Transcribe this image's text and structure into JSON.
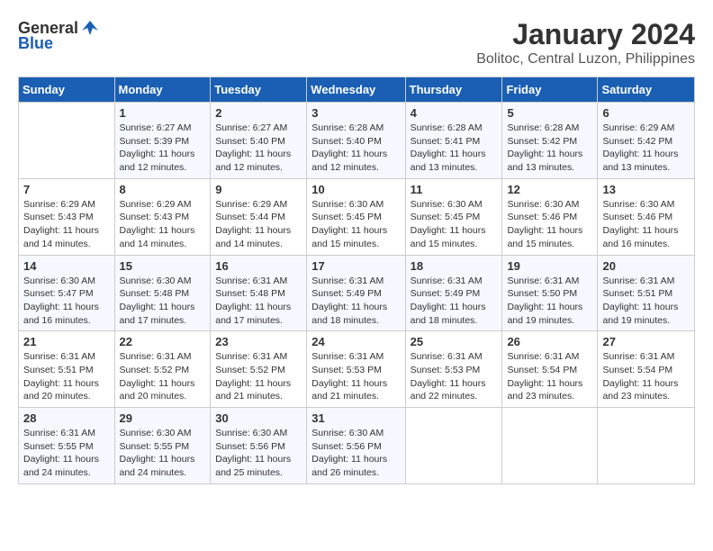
{
  "logo": {
    "general": "General",
    "blue": "Blue"
  },
  "title": "January 2024",
  "location": "Bolitoc, Central Luzon, Philippines",
  "days_header": [
    "Sunday",
    "Monday",
    "Tuesday",
    "Wednesday",
    "Thursday",
    "Friday",
    "Saturday"
  ],
  "weeks": [
    [
      {
        "day": "",
        "sunrise": "",
        "sunset": "",
        "daylight": ""
      },
      {
        "day": "1",
        "sunrise": "6:27 AM",
        "sunset": "5:39 PM",
        "daylight": "11 hours and 12 minutes."
      },
      {
        "day": "2",
        "sunrise": "6:27 AM",
        "sunset": "5:40 PM",
        "daylight": "11 hours and 12 minutes."
      },
      {
        "day": "3",
        "sunrise": "6:28 AM",
        "sunset": "5:40 PM",
        "daylight": "11 hours and 12 minutes."
      },
      {
        "day": "4",
        "sunrise": "6:28 AM",
        "sunset": "5:41 PM",
        "daylight": "11 hours and 13 minutes."
      },
      {
        "day": "5",
        "sunrise": "6:28 AM",
        "sunset": "5:42 PM",
        "daylight": "11 hours and 13 minutes."
      },
      {
        "day": "6",
        "sunrise": "6:29 AM",
        "sunset": "5:42 PM",
        "daylight": "11 hours and 13 minutes."
      }
    ],
    [
      {
        "day": "7",
        "sunrise": "6:29 AM",
        "sunset": "5:43 PM",
        "daylight": "11 hours and 14 minutes."
      },
      {
        "day": "8",
        "sunrise": "6:29 AM",
        "sunset": "5:43 PM",
        "daylight": "11 hours and 14 minutes."
      },
      {
        "day": "9",
        "sunrise": "6:29 AM",
        "sunset": "5:44 PM",
        "daylight": "11 hours and 14 minutes."
      },
      {
        "day": "10",
        "sunrise": "6:30 AM",
        "sunset": "5:45 PM",
        "daylight": "11 hours and 15 minutes."
      },
      {
        "day": "11",
        "sunrise": "6:30 AM",
        "sunset": "5:45 PM",
        "daylight": "11 hours and 15 minutes."
      },
      {
        "day": "12",
        "sunrise": "6:30 AM",
        "sunset": "5:46 PM",
        "daylight": "11 hours and 15 minutes."
      },
      {
        "day": "13",
        "sunrise": "6:30 AM",
        "sunset": "5:46 PM",
        "daylight": "11 hours and 16 minutes."
      }
    ],
    [
      {
        "day": "14",
        "sunrise": "6:30 AM",
        "sunset": "5:47 PM",
        "daylight": "11 hours and 16 minutes."
      },
      {
        "day": "15",
        "sunrise": "6:30 AM",
        "sunset": "5:48 PM",
        "daylight": "11 hours and 17 minutes."
      },
      {
        "day": "16",
        "sunrise": "6:31 AM",
        "sunset": "5:48 PM",
        "daylight": "11 hours and 17 minutes."
      },
      {
        "day": "17",
        "sunrise": "6:31 AM",
        "sunset": "5:49 PM",
        "daylight": "11 hours and 18 minutes."
      },
      {
        "day": "18",
        "sunrise": "6:31 AM",
        "sunset": "5:49 PM",
        "daylight": "11 hours and 18 minutes."
      },
      {
        "day": "19",
        "sunrise": "6:31 AM",
        "sunset": "5:50 PM",
        "daylight": "11 hours and 19 minutes."
      },
      {
        "day": "20",
        "sunrise": "6:31 AM",
        "sunset": "5:51 PM",
        "daylight": "11 hours and 19 minutes."
      }
    ],
    [
      {
        "day": "21",
        "sunrise": "6:31 AM",
        "sunset": "5:51 PM",
        "daylight": "11 hours and 20 minutes."
      },
      {
        "day": "22",
        "sunrise": "6:31 AM",
        "sunset": "5:52 PM",
        "daylight": "11 hours and 20 minutes."
      },
      {
        "day": "23",
        "sunrise": "6:31 AM",
        "sunset": "5:52 PM",
        "daylight": "11 hours and 21 minutes."
      },
      {
        "day": "24",
        "sunrise": "6:31 AM",
        "sunset": "5:53 PM",
        "daylight": "11 hours and 21 minutes."
      },
      {
        "day": "25",
        "sunrise": "6:31 AM",
        "sunset": "5:53 PM",
        "daylight": "11 hours and 22 minutes."
      },
      {
        "day": "26",
        "sunrise": "6:31 AM",
        "sunset": "5:54 PM",
        "daylight": "11 hours and 23 minutes."
      },
      {
        "day": "27",
        "sunrise": "6:31 AM",
        "sunset": "5:54 PM",
        "daylight": "11 hours and 23 minutes."
      }
    ],
    [
      {
        "day": "28",
        "sunrise": "6:31 AM",
        "sunset": "5:55 PM",
        "daylight": "11 hours and 24 minutes."
      },
      {
        "day": "29",
        "sunrise": "6:30 AM",
        "sunset": "5:55 PM",
        "daylight": "11 hours and 24 minutes."
      },
      {
        "day": "30",
        "sunrise": "6:30 AM",
        "sunset": "5:56 PM",
        "daylight": "11 hours and 25 minutes."
      },
      {
        "day": "31",
        "sunrise": "6:30 AM",
        "sunset": "5:56 PM",
        "daylight": "11 hours and 26 minutes."
      },
      {
        "day": "",
        "sunrise": "",
        "sunset": "",
        "daylight": ""
      },
      {
        "day": "",
        "sunrise": "",
        "sunset": "",
        "daylight": ""
      },
      {
        "day": "",
        "sunrise": "",
        "sunset": "",
        "daylight": ""
      }
    ]
  ]
}
